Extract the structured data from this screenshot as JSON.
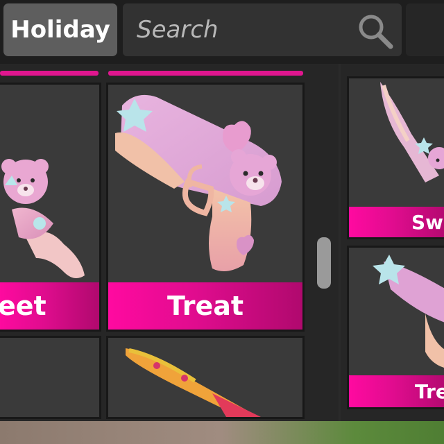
{
  "toolbar": {
    "filter_label": "Holiday",
    "search_placeholder": "Search",
    "search_icon": "search-icon"
  },
  "items": [
    {
      "label": "eet",
      "icon": "teddy-candy-knife"
    },
    {
      "label": "Treat",
      "icon": "teddy-pastel-gun"
    },
    {
      "label": "",
      "icon": "empty"
    },
    {
      "label": "",
      "icon": "candy-knife-partial"
    }
  ],
  "side_items": [
    {
      "label": "Swe",
      "icon": "pastel-knife"
    },
    {
      "label": "Tre",
      "icon": "pastel-gun-partial"
    }
  ],
  "colors": {
    "accent_pink": "#e0168f",
    "panel_bg": "#262626",
    "card_bg": "#3a3a3a",
    "button_bg": "#5e5e5e"
  }
}
